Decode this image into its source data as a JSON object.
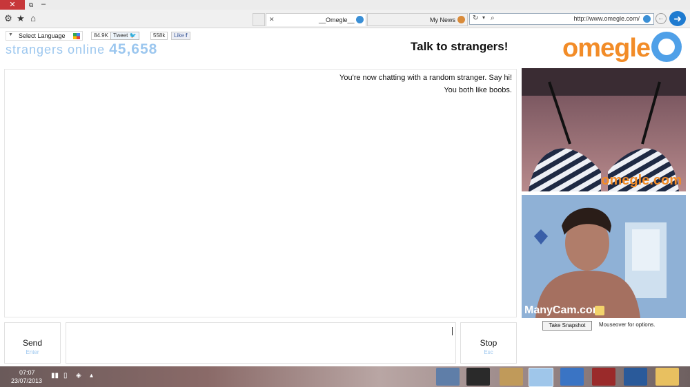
{
  "browser": {
    "window_controls": {
      "close": "✕",
      "restore": "⧉",
      "minimize": "–"
    },
    "address": {
      "url": "http://www.omegle.com/"
    },
    "tabs": [
      {
        "label": "My News"
      },
      {
        "label": "__Omegle__",
        "close": "✕"
      }
    ]
  },
  "header": {
    "language": {
      "label": "Select Language"
    },
    "tweet": {
      "label": "Tweet",
      "count": "84.9K"
    },
    "like": {
      "label": "Like",
      "count": "558k"
    },
    "online": {
      "count": "45,658",
      "label": "strangers online"
    },
    "tagline": "Talk to strangers!",
    "logo": "omegle"
  },
  "chat": {
    "messages": [
      "You're now chatting with a random stranger. Say hi!",
      "You both like boobs."
    ]
  },
  "video": {
    "stranger_watermark": "omegle.com",
    "self_watermark": "ManyCam.com"
  },
  "controls": {
    "send": {
      "label": "Send",
      "hint": "Enter"
    },
    "stop": {
      "label": "Stop",
      "hint": "Esc"
    },
    "snapshot_label": "Take Snapshot",
    "mouseover_text": "Mouseover for options."
  },
  "taskbar": {
    "time": "07:07",
    "date": "23/07/2013",
    "apps": [
      "explorer",
      "ie",
      "skype",
      "mail",
      "paint",
      "app-13",
      "network-icon",
      "folder"
    ]
  },
  "colors": {
    "accent": "#1f7bd0",
    "logo_orange": "#f28c28",
    "logo_blue": "#4fa0e8",
    "online_blue": "#9cc7ef"
  }
}
